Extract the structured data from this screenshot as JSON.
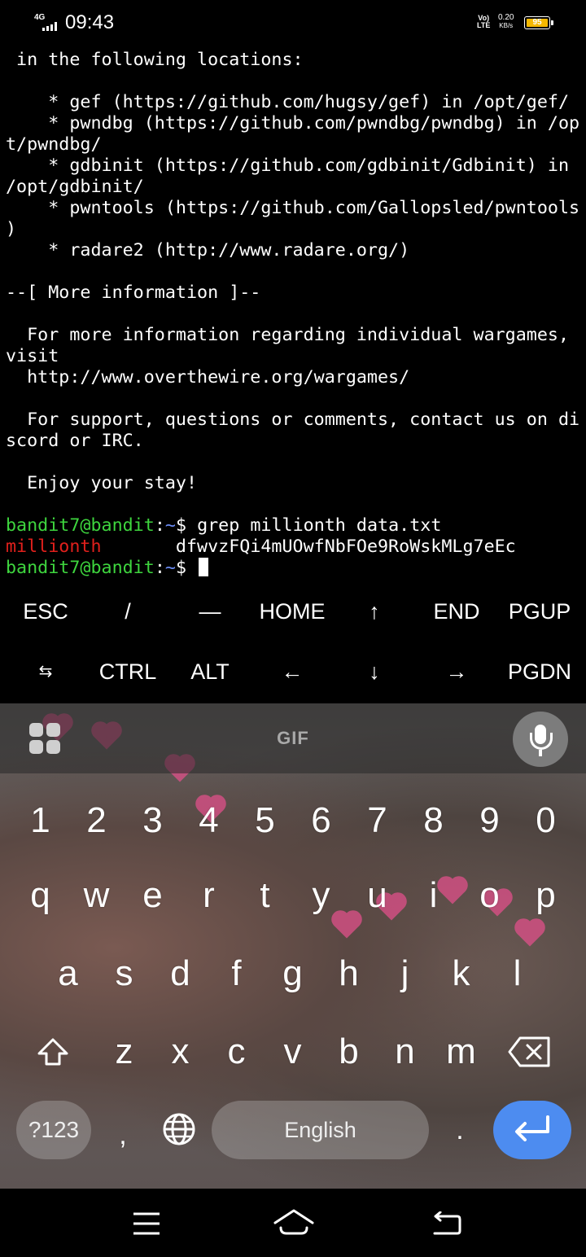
{
  "status_bar": {
    "network": "4G",
    "time": "09:43",
    "volte_line1": "Vo)",
    "volte_line2": "LTE",
    "speed_value": "0.20",
    "speed_unit": "KB/s",
    "battery": "95"
  },
  "terminal": {
    "lines": [
      " in the following locations:",
      "",
      "    * gef (https://github.com/hugsy/gef) in /opt/gef/",
      "    * pwndbg (https://github.com/pwndbg/pwndbg) in /op",
      "t/pwndbg/",
      "    * gdbinit (https://github.com/gdbinit/Gdbinit) in",
      "/opt/gdbinit/",
      "    * pwntools (https://github.com/Gallopsled/pwntools",
      ")",
      "    * radare2 (http://www.radare.org/)",
      "",
      "--[ More information ]--",
      "",
      "  For more information regarding individual wargames,",
      "visit",
      "  http://www.overthewire.org/wargames/",
      "",
      "  For support, questions or comments, contact us on di",
      "scord or IRC.",
      "",
      "  Enjoy your stay!",
      ""
    ],
    "prompt_user": "bandit7@bandit",
    "prompt_colon": ":",
    "prompt_path": "~",
    "prompt_symbol": "$ ",
    "command": "grep millionth data.txt",
    "match_word": "millionth",
    "match_rest": "       dfwvzFQi4mUOwfNbFOe9RoWskMLg7eEc"
  },
  "extra_keys": {
    "row1": [
      "ESC",
      "/",
      "—",
      "HOME",
      "↑",
      "END",
      "PGUP"
    ],
    "row2": [
      "⇆",
      "CTRL",
      "ALT",
      "←",
      "↓",
      "→",
      "PGDN"
    ]
  },
  "keyboard": {
    "gif_label": "GIF",
    "numbers": [
      "1",
      "2",
      "3",
      "4",
      "5",
      "6",
      "7",
      "8",
      "9",
      "0"
    ],
    "row_q": [
      "q",
      "w",
      "e",
      "r",
      "t",
      "y",
      "u",
      "i",
      "o",
      "p"
    ],
    "row_a": [
      "a",
      "s",
      "d",
      "f",
      "g",
      "h",
      "j",
      "k",
      "l"
    ],
    "row_z": [
      "z",
      "x",
      "c",
      "v",
      "b",
      "n",
      "m"
    ],
    "symbols_label": "?123",
    "comma": ",",
    "space_label": "English",
    "period": "."
  },
  "colors": {
    "prompt_green": "#3ed53e",
    "path_blue": "#6b8cf5",
    "match_red": "#e0201c",
    "enter_blue": "#4d8cf0",
    "battery_yellow": "#f5b800"
  }
}
